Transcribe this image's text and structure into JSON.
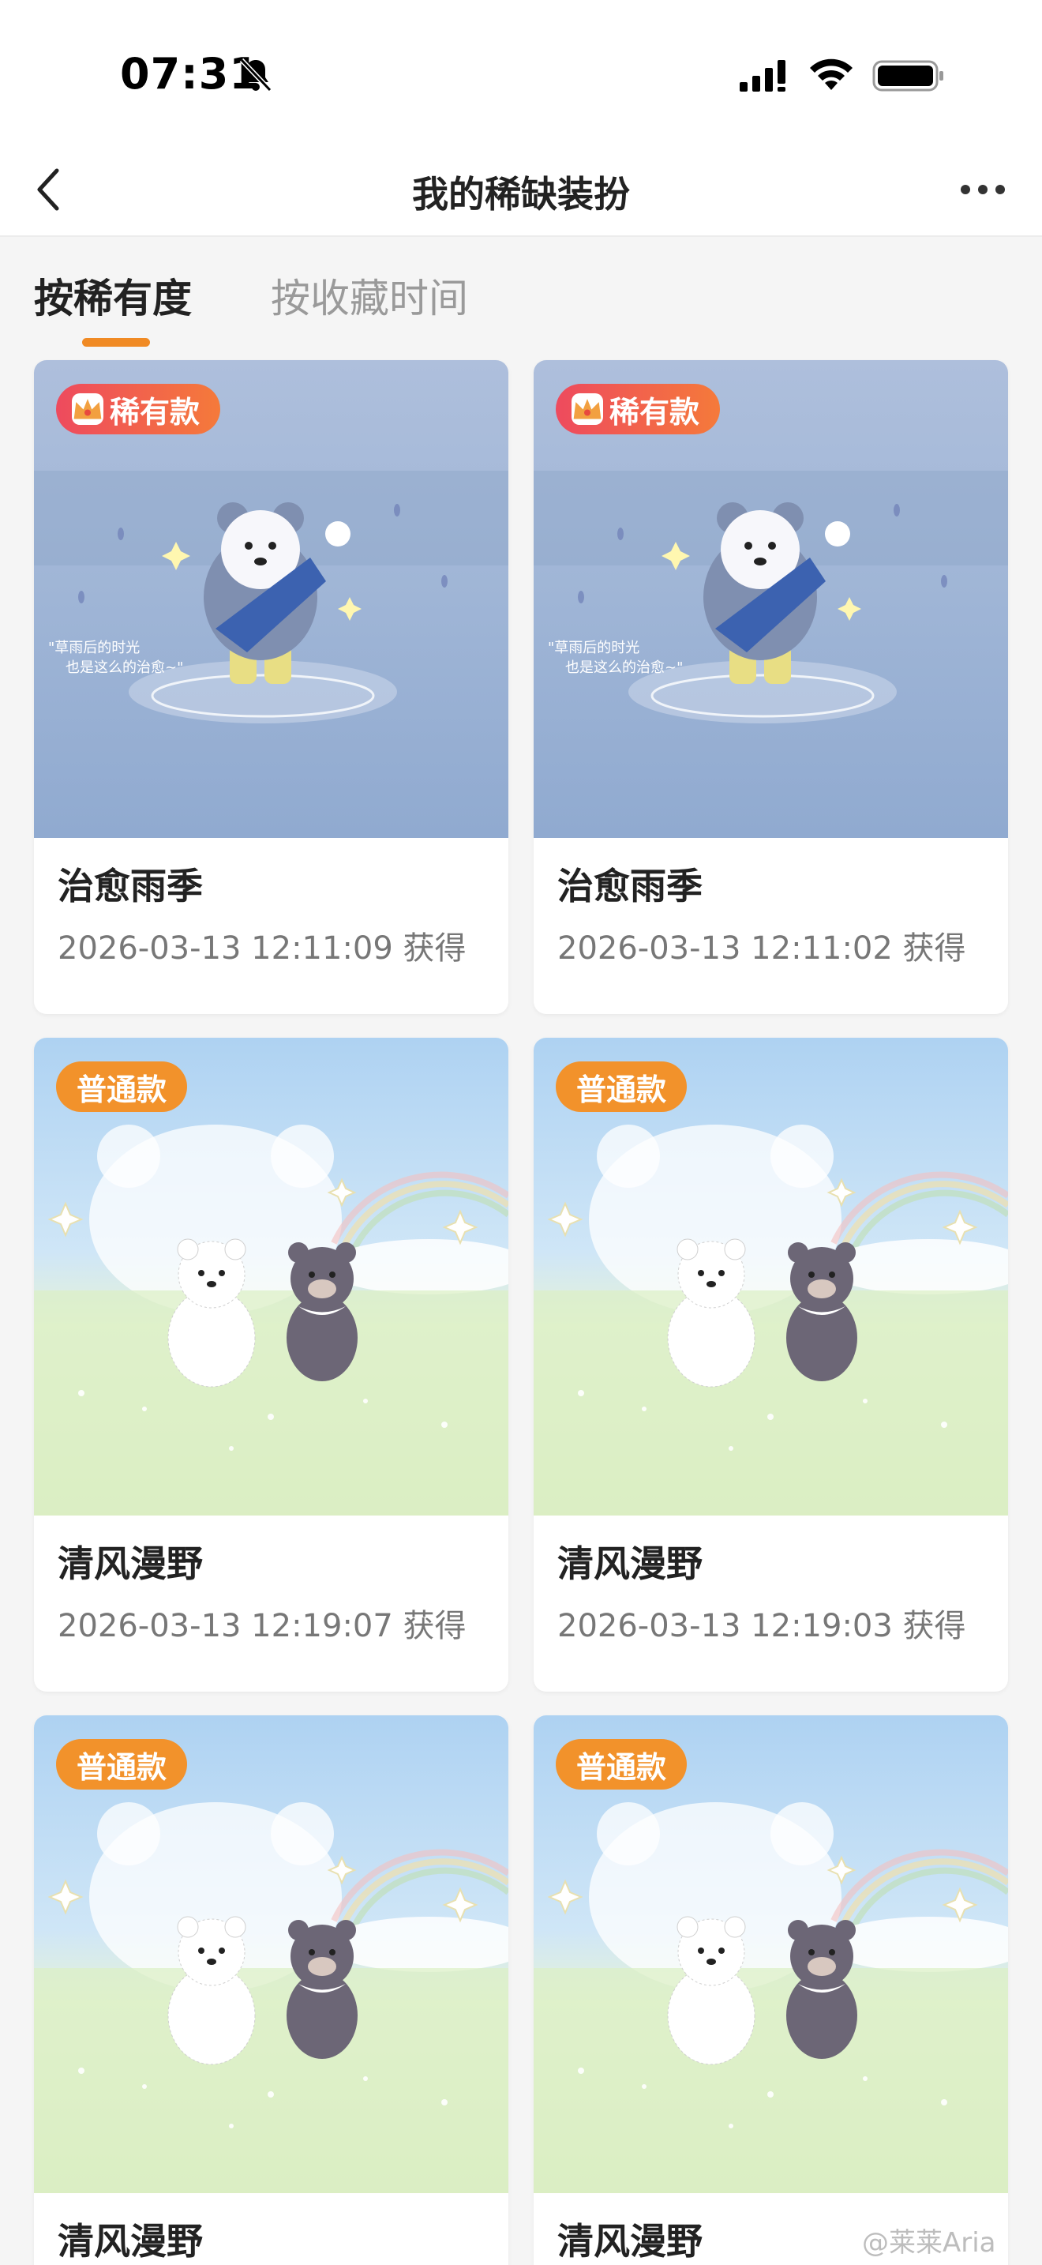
{
  "status_bar": {
    "time": "07:31",
    "icons": [
      "bell-muted-icon",
      "signal-icon",
      "wifi-icon",
      "battery-icon"
    ]
  },
  "nav": {
    "title": "我的稀缺装扮",
    "back_icon": "chevron-left-icon",
    "more_icon": "more-horizontal-icon"
  },
  "tabs": [
    {
      "label": "按稀有度",
      "active": true
    },
    {
      "label": "按收藏时间",
      "active": false
    }
  ],
  "colors": {
    "accent": "#f08a24",
    "rare_badge": "#ee4a5e",
    "common_badge": "#f2922b"
  },
  "cards": [
    {
      "badge": "稀有款",
      "badge_type": "rare",
      "title": "治愈雨季",
      "date": "2026-03-13 12:11:09 获得",
      "art": "rain-bear"
    },
    {
      "badge": "稀有款",
      "badge_type": "rare",
      "title": "治愈雨季",
      "date": "2026-03-13 12:11:02 获得",
      "art": "rain-bear"
    },
    {
      "badge": "普通款",
      "badge_type": "common",
      "title": "清风漫野",
      "date": "2026-03-13 12:19:07 获得",
      "art": "meadow-bears"
    },
    {
      "badge": "普通款",
      "badge_type": "common",
      "title": "清风漫野",
      "date": "2026-03-13 12:19:03 获得",
      "art": "meadow-bears"
    },
    {
      "badge": "普通款",
      "badge_type": "common",
      "title": "清风漫野",
      "date": "",
      "art": "meadow-bears"
    },
    {
      "badge": "普通款",
      "badge_type": "common",
      "title": "清风漫野",
      "date": "",
      "art": "meadow-bears"
    }
  ],
  "watermark": "@莱莱Aria"
}
